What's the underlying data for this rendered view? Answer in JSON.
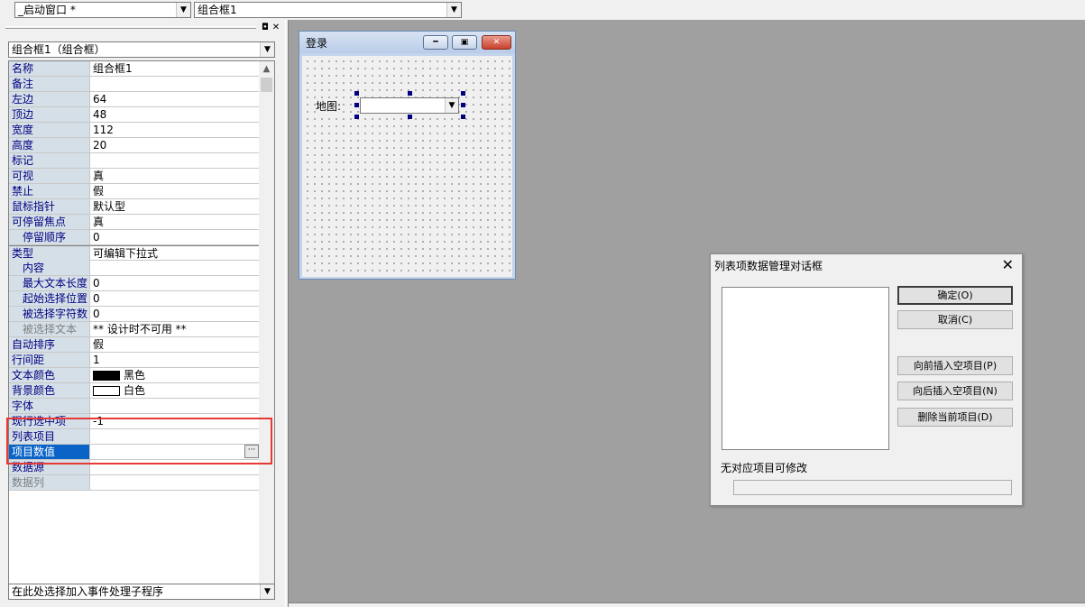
{
  "toolbar": {
    "window_select": "_启动窗口 *",
    "component_select": "组合框1"
  },
  "property_panel": {
    "object_select": "组合框1（组合框）",
    "properties": [
      {
        "name": "名称",
        "value": "组合框1"
      },
      {
        "name": "备注",
        "value": ""
      },
      {
        "name": "左边",
        "value": "64"
      },
      {
        "name": "顶边",
        "value": "48"
      },
      {
        "name": "宽度",
        "value": "112"
      },
      {
        "name": "高度",
        "value": "20"
      },
      {
        "name": "标记",
        "value": ""
      },
      {
        "name": "可视",
        "value": "真"
      },
      {
        "name": "禁止",
        "value": "假"
      },
      {
        "name": "鼠标指针",
        "value": "默认型"
      },
      {
        "name": "可停留焦点",
        "value": "真"
      },
      {
        "name": "停留顺序",
        "value": "0"
      },
      {
        "name": "类型",
        "value": "可编辑下拉式"
      },
      {
        "name": "内容",
        "value": ""
      },
      {
        "name": "最大文本长度",
        "value": "0"
      },
      {
        "name": "起始选择位置",
        "value": "0"
      },
      {
        "name": "被选择字符数",
        "value": "0"
      },
      {
        "name": "被选择文本",
        "value": "** 设计时不可用 **"
      },
      {
        "name": "自动排序",
        "value": "假"
      },
      {
        "name": "行间距",
        "value": "1"
      },
      {
        "name": "文本颜色",
        "value": "黑色",
        "color": "#000000"
      },
      {
        "name": "背景颜色",
        "value": "白色",
        "color": "#ffffff"
      },
      {
        "name": "字体",
        "value": ""
      },
      {
        "name": "现行选中项",
        "value": "-1"
      },
      {
        "name": "列表项目",
        "value": ""
      },
      {
        "name": "项目数值",
        "value": ""
      },
      {
        "name": "数据源",
        "value": ""
      },
      {
        "name": "数据列",
        "value": ""
      }
    ],
    "event_select": "在此处选择加入事件处理子程序"
  },
  "login_window": {
    "title": "登录",
    "map_label": "地图:"
  },
  "dialog": {
    "title": "列表项数据管理对话框",
    "ok_button": "确定(O)",
    "cancel_button": "取消(C)",
    "insert_before_button": "向前插入空项目(P)",
    "insert_after_button": "向后插入空项目(N)",
    "delete_button": "删除当前项目(D)",
    "status_text": "无对应项目可修改"
  },
  "colors": {
    "accent": "#0a64c8",
    "highlight_box": "#e53935"
  }
}
